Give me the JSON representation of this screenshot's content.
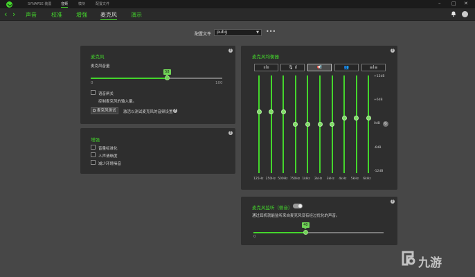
{
  "app": {
    "menu": [
      "SYNAPSE 装置",
      "音频",
      "模块",
      "配置文件"
    ],
    "active_menu": 1
  },
  "subtabs": [
    "声音",
    "校准",
    "增强",
    "麦克风",
    "演示"
  ],
  "active_subtab": 3,
  "profile": {
    "label": "配置文件",
    "value": "pubg",
    "more": "•••"
  },
  "mic_panel": {
    "title": "麦克风",
    "volume_label": "麦克风音量",
    "volume_value": "58",
    "volume_level": 58,
    "min": "0",
    "max": "100",
    "voice_gate_label": "语音闸关",
    "voice_gate_desc": "控制麦克风的输入量。",
    "test_button": "麦克风测试",
    "test_desc": "激活以测试麦克风的音频设置"
  },
  "enhance_panel": {
    "title": "增强",
    "options": [
      "音量标准化",
      "人声清晰度",
      "减少环境噪音"
    ]
  },
  "eq_panel": {
    "title": "麦克风均衡器",
    "presets": [
      "ıılıı",
      "🎙 ıl",
      "📢",
      "👥",
      "≡l≡"
    ],
    "active_preset": 2,
    "bands": [
      "125Hz",
      "250Hz",
      "500Hz",
      "750Hz",
      "1kHz",
      "2kHz",
      "3kHz",
      "4kHz",
      "5kHz",
      "6kHz"
    ],
    "band_gains_db": [
      3,
      3,
      3,
      0,
      0,
      0,
      0,
      1.5,
      1.5,
      1.5
    ],
    "db_labels": [
      "+12dB",
      "+6dB",
      "0dB",
      "-6dB",
      "-12dB"
    ],
    "reset_icon": "↻"
  },
  "monitor_panel": {
    "title": "麦克风监听（侧音）",
    "desc": "通过耳机就能监听来自麦克风没有经过优化的声音。",
    "value": "40",
    "level": 40,
    "min": "0"
  },
  "watermark": "九游",
  "colors": {
    "accent": "#44d62c",
    "panel": "#2e2e2e",
    "bg": "#474747"
  }
}
